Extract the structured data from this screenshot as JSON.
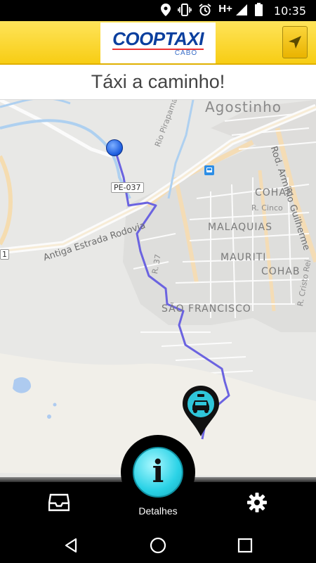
{
  "status_bar": {
    "network": "H+",
    "time": "10:35",
    "icons": [
      "location-icon",
      "vibrate-icon",
      "alarm-icon",
      "signal-icon",
      "battery-icon"
    ]
  },
  "header": {
    "brand": "COOPTAXI",
    "brand_sub": "CABO",
    "locate_icon": "navigation-arrow-icon"
  },
  "title": "Táxi a caminho!",
  "map": {
    "labels": {
      "agostinho": "Agostinho",
      "rio_pirapama": "Rio Pirapama",
      "rod_arminio": "Rod. Armínio Guilherme",
      "cohab_1": "COHAB",
      "cohab_2": "COHAB",
      "r_cinco": "R. Cinco",
      "malaquias": "MALAQUIAS",
      "mauriti": "MAURITI",
      "sao_francisco": "SÃO FRANCISCO",
      "pe037": "PE-037",
      "antiga_estrada": "Antiga Estrada Rodovia",
      "r37": "R. 37",
      "r_cristo_rei": "R. Cristo Rei",
      "shield_1": "1"
    }
  },
  "bottom_bar": {
    "inbox_icon": "inbox-icon",
    "details_label": "Detalhes",
    "details_icon_text": "i",
    "settings_icon": "gear-icon"
  },
  "system_nav": [
    "back-icon",
    "home-icon",
    "recents-icon"
  ],
  "colors": {
    "header_yellow": "#f7cd14",
    "brand_blue": "#0b3f9e",
    "route": "#6b63e0",
    "details_cyan": "#2ad2e6",
    "map_bg": "#e8e8e6"
  }
}
